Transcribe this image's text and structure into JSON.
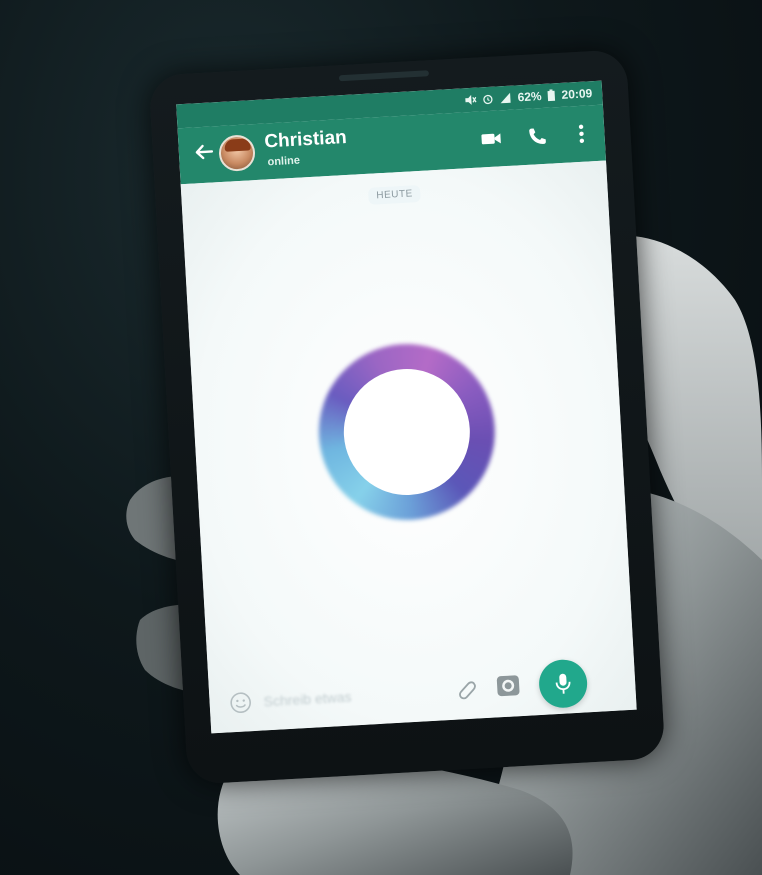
{
  "status_bar": {
    "battery": "62%",
    "time": "20:09",
    "icons": [
      "mute-icon",
      "alarm-icon",
      "signal-icon",
      "battery-icon"
    ]
  },
  "chat_header": {
    "back_icon": "arrow-left-icon",
    "contact_name": "Christian",
    "contact_status": "online",
    "actions": [
      "video-call-icon",
      "phone-call-icon",
      "more-vertical-icon"
    ]
  },
  "chat": {
    "date_label": "HEUTE"
  },
  "input_bar": {
    "placeholder": "Schreib etwas",
    "icons": [
      "emoji-icon",
      "attach-icon",
      "camera-icon",
      "mic-icon"
    ]
  },
  "colors": {
    "header_green": "#23876b",
    "status_green": "#1f7d64",
    "mic_button": "#21a88c",
    "ring_purple": "#8a5cc0",
    "ring_blue": "#86d1ea"
  }
}
